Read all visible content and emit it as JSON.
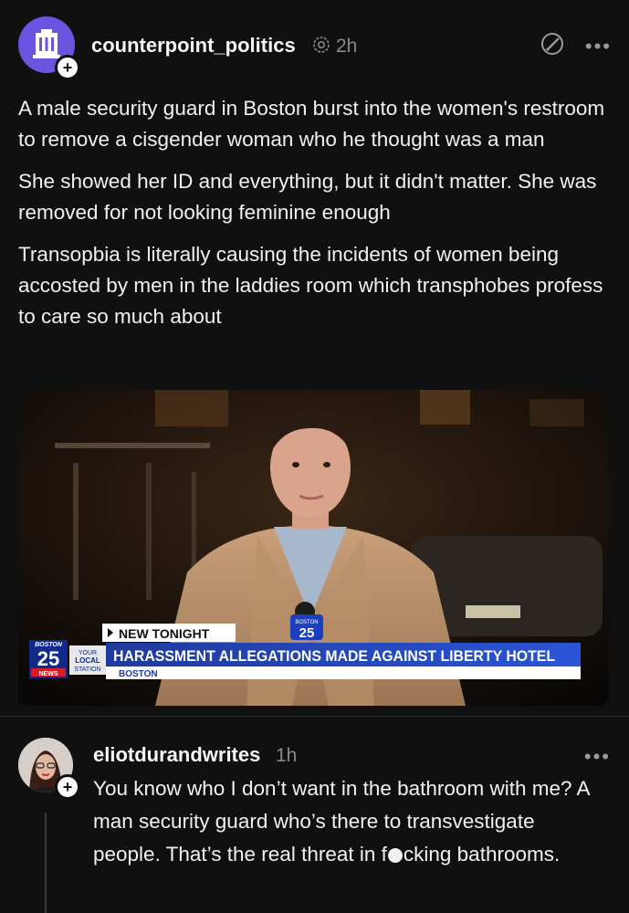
{
  "post": {
    "username": "counterpoint_politics",
    "time": "2h",
    "paragraphs": [
      "A male security guard in Boston burst into the women's restroom to remove a cisgender woman who he thought was a man",
      "She showed her ID and everything, but it didn't matter. She was removed for not looking feminine enough",
      "Transopbia is literally causing the incidents of women being accosted by men in the laddies room which transphobes profess to care so much about"
    ]
  },
  "news_graphic": {
    "kicker": "NEW TONIGHT",
    "headline": "HARASSMENT ALLEGATIONS MADE AGAINST LIBERTY HOTEL",
    "location": "BOSTON",
    "station_top": "BOSTON",
    "station_number": "25",
    "station_news": "NEWS",
    "tagline_1": "YOUR",
    "tagline_2": "LOCAL",
    "tagline_3": "STATION",
    "mic_top": "BOSTON",
    "mic_number": "25"
  },
  "reply": {
    "username": "eliotdurandwrites",
    "time": "1h",
    "text_part1": "You know who I don’t want in the bathroom with me? A man security guard who’s there to transvestigate people. That’s the real threat in f",
    "text_part2": "cking bathrooms."
  },
  "colors": {
    "background": "#101010",
    "avatar_purple": "#6b55e0",
    "banner_blue": "#1f3a9e",
    "meta_gray": "#8a8a8a"
  },
  "icons": {
    "profile": "building-icon",
    "add": "plus-icon",
    "verified": "verified-icon",
    "edit": "edit-icon",
    "menu": "more-dots-icon"
  }
}
